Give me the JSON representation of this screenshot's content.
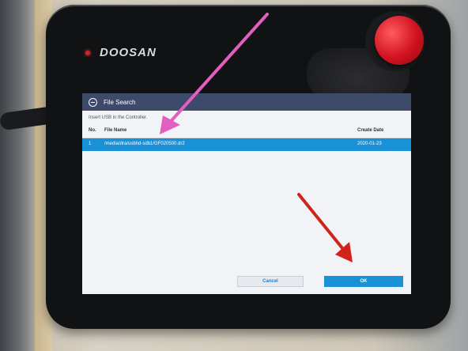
{
  "device": {
    "brand": "DOOSAN"
  },
  "dialog": {
    "title": "File Search",
    "subtitle": "Insert USB in the Controller.",
    "columns": {
      "no": "No.",
      "file_name": "File Name",
      "create_date": "Create Date"
    },
    "rows": [
      {
        "no": "1",
        "file_name": "/media/dra/usbhd-sdb1/GF020500.dr2",
        "create_date": "2020-01-23"
      }
    ],
    "buttons": {
      "cancel": "Cancel",
      "ok": "OK"
    }
  },
  "colors": {
    "title_bar": "#3d4a6a",
    "selection": "#1a90d6",
    "pink_arrow": "#e25fc0",
    "red_arrow": "#d0241b",
    "estop": "#d1121f"
  }
}
